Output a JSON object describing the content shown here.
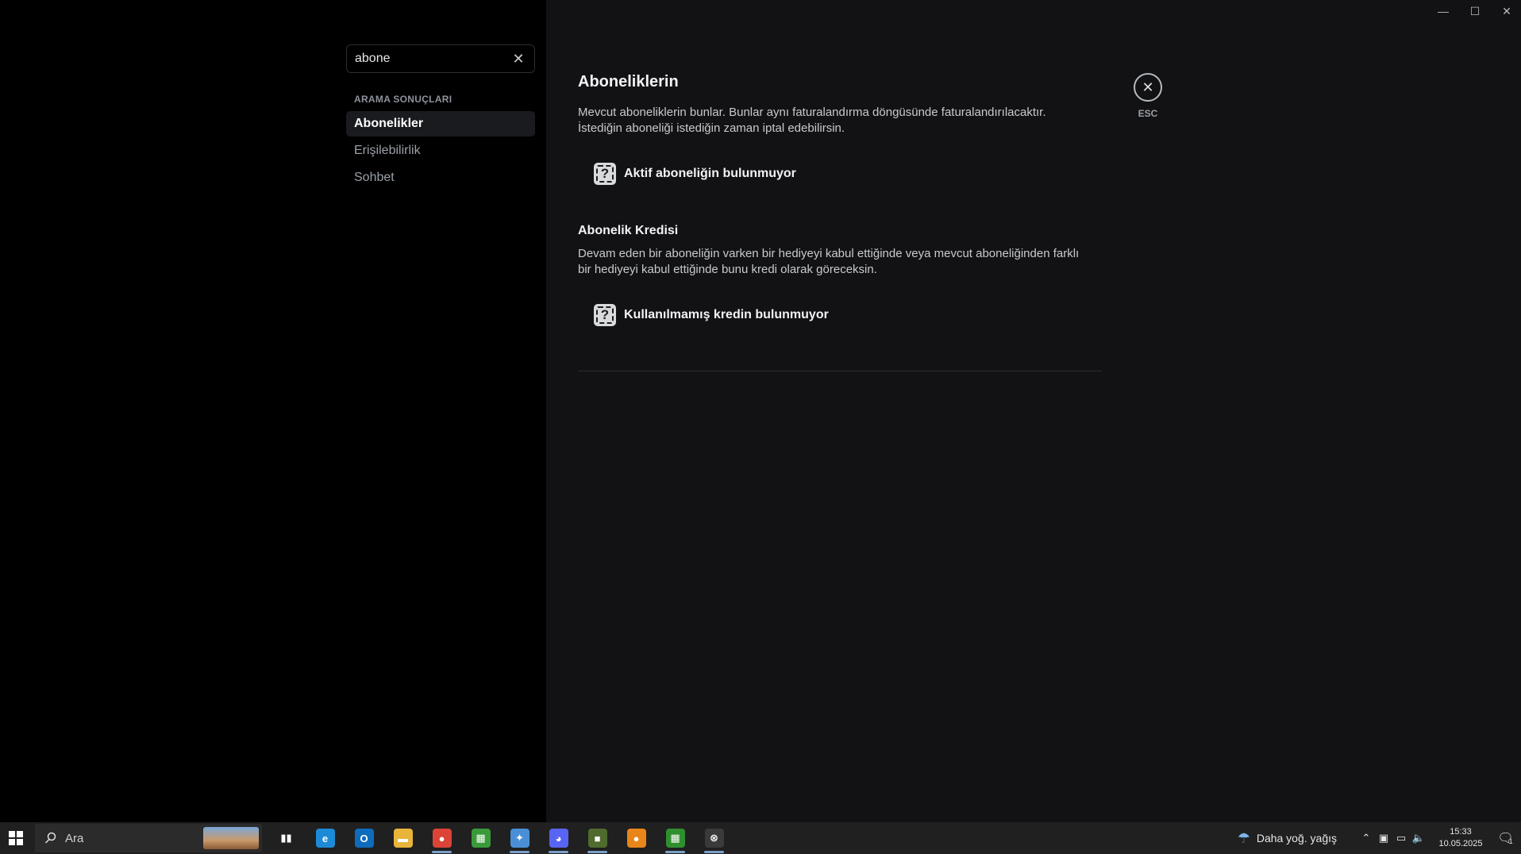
{
  "window": {
    "minimize": "—",
    "maximize": "☐",
    "close": "✕"
  },
  "search": {
    "value": "abone",
    "clear": "✕"
  },
  "sidebar": {
    "section_title": "ARAMA SONUÇLARI",
    "items": [
      {
        "label": "Abonelikler",
        "active": true
      },
      {
        "label": "Erişilebilirlik",
        "active": false
      },
      {
        "label": "Sohbet",
        "active": false
      }
    ]
  },
  "main": {
    "title": "Aboneliklerin",
    "description_1": "Mevcut aboneliklerin bunlar. Bunlar aynı faturalandırma döngüsünde faturalandırılacaktır.",
    "description_2": "İstediğin aboneliği istediğin zaman iptal edebilirsin.",
    "no_subscription": "Aktif aboneliğin bulunmuyor",
    "credit_title": "Abonelik Kredisi",
    "credit_desc_1": "Devam eden bir aboneliğin varken bir hediyeyi kabul ettiğinde veya mevcut aboneliğinden farklı",
    "credit_desc_2": "bir hediyeyi kabul ettiğinde bunu kredi olarak göreceksin.",
    "no_credit": "Kullanılmamış kredin bulunmuyor",
    "empty_icon": "?"
  },
  "esc": {
    "icon": "✕",
    "label": "ESC"
  },
  "taskbar": {
    "search_placeholder": "Ara",
    "weather": "Daha yoğ. yağış",
    "time": "15:33",
    "date": "10.05.2025",
    "notification_count": "1",
    "apps": [
      {
        "name": "task-view-icon",
        "glyph": "▮▮",
        "color": "#202020",
        "running": false
      },
      {
        "name": "edge-icon",
        "glyph": "e",
        "color": "#1c8ad6",
        "running": false
      },
      {
        "name": "outlook-icon",
        "glyph": "O",
        "color": "#0f6cbd",
        "running": false
      },
      {
        "name": "file-explorer-icon",
        "glyph": "▬",
        "color": "#e8b43a",
        "running": false
      },
      {
        "name": "chrome-icon",
        "glyph": "●",
        "color": "#db4437",
        "running": true
      },
      {
        "name": "minecraft-icon",
        "glyph": "▦",
        "color": "#3a9a3a",
        "running": false
      },
      {
        "name": "settings-app-icon",
        "glyph": "✦",
        "color": "#4a8fd6",
        "running": true
      },
      {
        "name": "discord-icon",
        "glyph": "◕",
        "color": "#5865f2",
        "running": true
      },
      {
        "name": "minecraft-block-icon",
        "glyph": "■",
        "color": "#4f6b2d",
        "running": true
      },
      {
        "name": "microphone-icon",
        "glyph": "●",
        "color": "#e8861a",
        "running": false
      },
      {
        "name": "minecraft-launcher-icon",
        "glyph": "▦",
        "color": "#2f8f2f",
        "running": true
      },
      {
        "name": "xbox-icon",
        "glyph": "⊗",
        "color": "#3a3a3a",
        "running": true
      }
    ]
  }
}
